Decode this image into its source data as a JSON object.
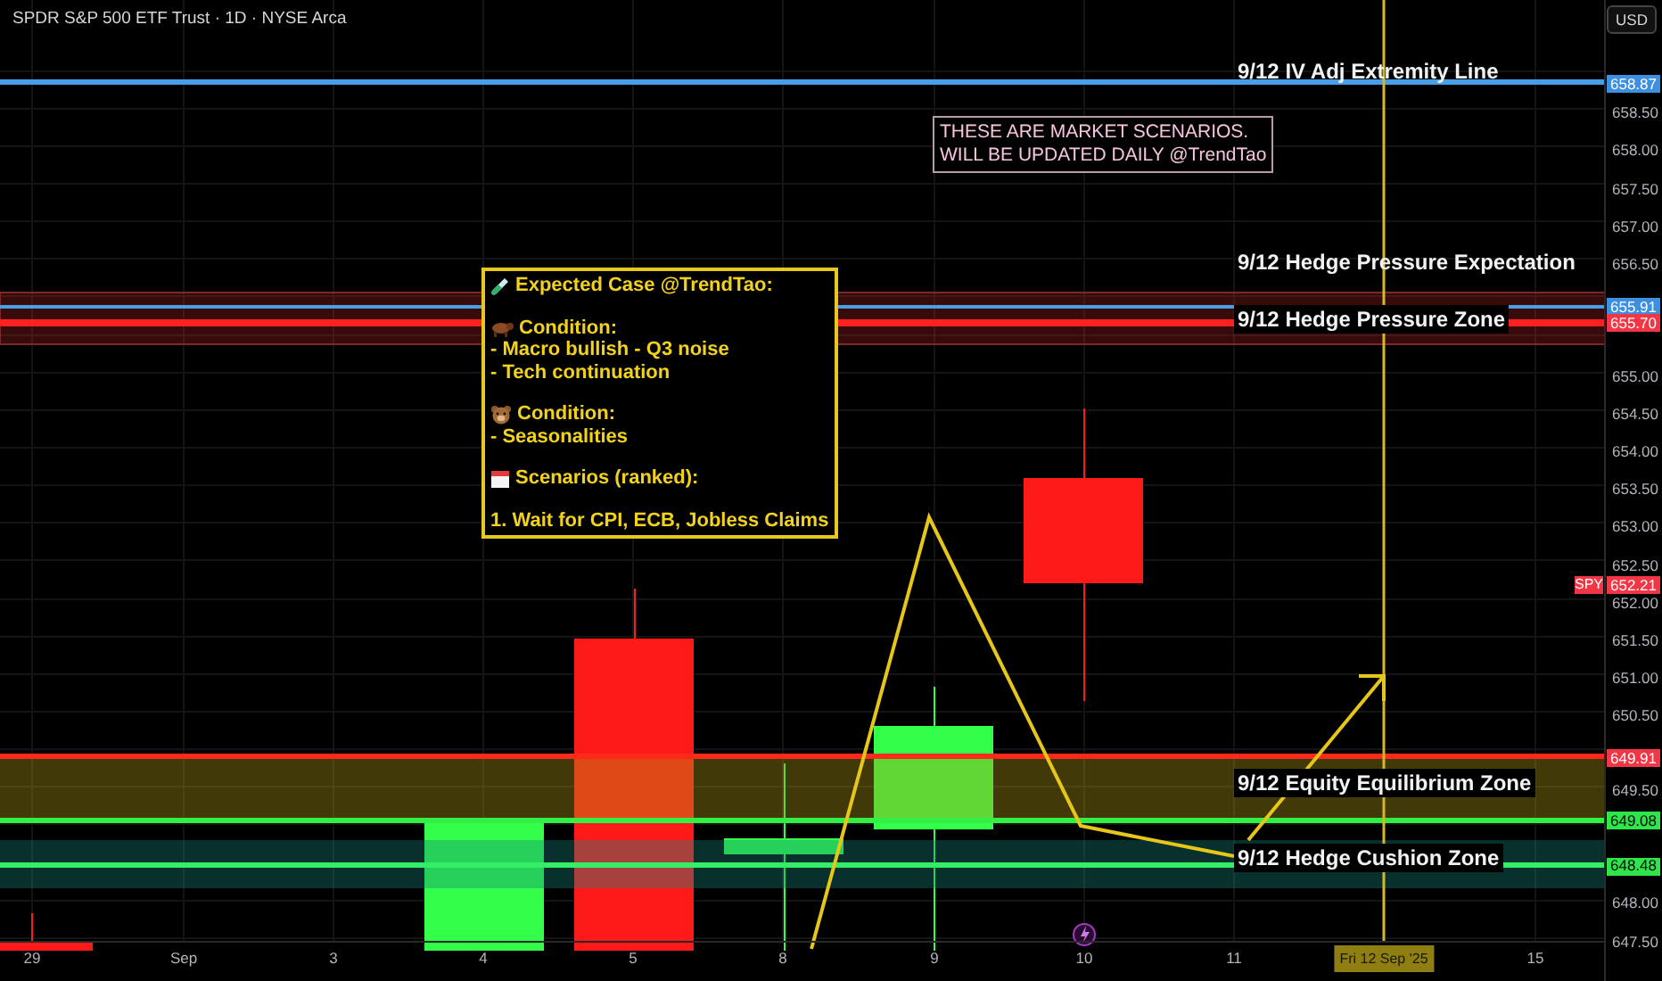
{
  "header": {
    "title": "SPDR S&P 500 ETF Trust · 1D · NYSE Arca"
  },
  "price_axis": {
    "currency_button": "USD",
    "ticks": [
      "658.50",
      "658.00",
      "657.50",
      "657.00",
      "656.50",
      "655.00",
      "654.50",
      "654.00",
      "653.50",
      "653.00",
      "652.50",
      "652.00",
      "651.50",
      "651.00",
      "650.50",
      "649.50",
      "648.00",
      "647.50"
    ],
    "markers": [
      {
        "label": "658.87",
        "color": "#3d8fe0"
      },
      {
        "label": "655.91",
        "color": "#3d8fe0"
      },
      {
        "label": "655.70",
        "color": "#f23645"
      },
      {
        "label": "652.21",
        "tag": "SPY",
        "color": "#f23645"
      },
      {
        "label": "649.91",
        "color": "#f23645"
      },
      {
        "label": "649.08",
        "color": "#2ee64a"
      },
      {
        "label": "648.48",
        "color": "#2ee64a"
      }
    ]
  },
  "time_axis": {
    "labels": [
      {
        "text": "29",
        "kind": "tick"
      },
      {
        "text": "Sep",
        "kind": "tick"
      },
      {
        "text": "3",
        "kind": "tick"
      },
      {
        "text": "4",
        "kind": "tick"
      },
      {
        "text": "5",
        "kind": "tick"
      },
      {
        "text": "8",
        "kind": "tick"
      },
      {
        "text": "9",
        "kind": "tick"
      },
      {
        "text": "10",
        "kind": "tick"
      },
      {
        "text": "11",
        "kind": "tick"
      },
      {
        "text": "Fri 12 Sep '25",
        "kind": "crosshair"
      },
      {
        "text": "15",
        "kind": "tick"
      }
    ]
  },
  "level_labels": [
    {
      "text": "9/12 IV Adj Extremity Line",
      "boxed": false
    },
    {
      "text": "9/12 Hedge Pressure Expectation",
      "boxed": false
    },
    {
      "text": "9/12 Hedge Pressure Zone",
      "boxed": true
    },
    {
      "text": "9/12 Equity Equilibrium Zone",
      "boxed": true
    },
    {
      "text": "9/12 Hedge Cushion Zone",
      "boxed": true
    }
  ],
  "scenario_notice": {
    "lines": [
      "THESE ARE MARKET SCENARIOS.",
      "WILL BE UPDATED DAILY @TrendTao"
    ]
  },
  "note": {
    "sections": [
      {
        "heading": "Expected Case @TrendTao:"
      },
      {
        "heading": "Condition:",
        "lines": [
          "- Macro bullish - Q3 noise",
          "- Tech continuation"
        ]
      },
      {
        "heading": "Condition:",
        "lines": [
          "- Seasonalities"
        ]
      },
      {
        "heading": "Scenarios (ranked):"
      },
      {
        "lines": [
          "1. Wait for CPI, ECB, Jobless Claims"
        ]
      }
    ]
  }
}
